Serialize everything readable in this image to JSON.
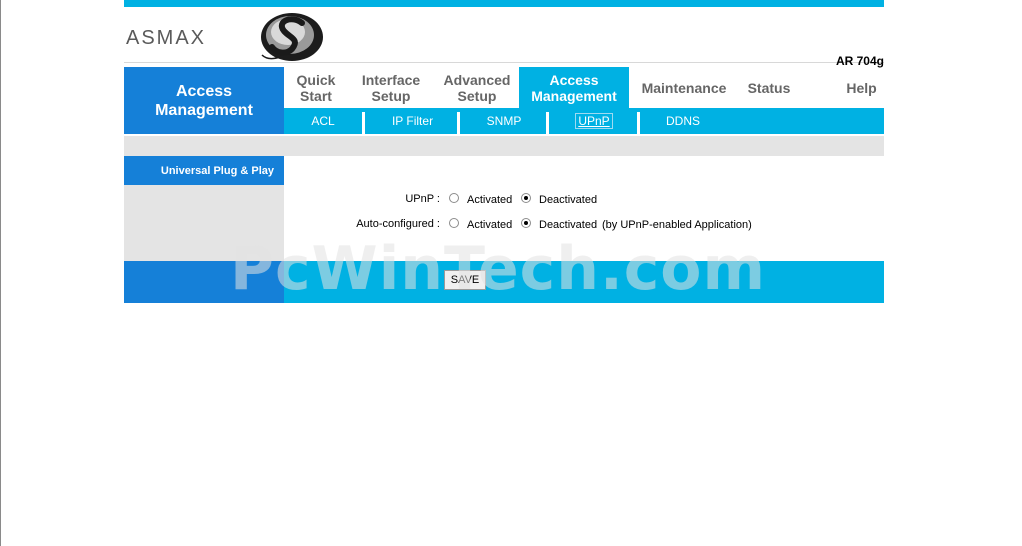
{
  "brand": {
    "name": "ASMAX",
    "model": "AR 704g"
  },
  "section_title": "Access\nManagement",
  "main_tabs": [
    {
      "label": "Quick\nStart"
    },
    {
      "label": "Interface\nSetup"
    },
    {
      "label": "Advanced\nSetup"
    },
    {
      "label": "Access\nManagement",
      "active": true
    },
    {
      "label": "Maintenance"
    },
    {
      "label": "Status"
    },
    {
      "label": "Help"
    }
  ],
  "sub_tabs": [
    {
      "label": "ACL"
    },
    {
      "label": "IP Filter"
    },
    {
      "label": "SNMP"
    },
    {
      "label": "UPnP",
      "active": true
    },
    {
      "label": "DDNS"
    }
  ],
  "sidebar": {
    "label": "Universal Plug & Play"
  },
  "form": {
    "upnp": {
      "label": "UPnP :",
      "activated": "Activated",
      "deactivated": "Deactivated",
      "selected": "Deactivated"
    },
    "auto_configured": {
      "label": "Auto-configured :",
      "activated": "Activated",
      "deactivated": "Deactivated",
      "note": "(by UPnP-enabled Application)",
      "selected": "Deactivated"
    }
  },
  "save_label": "SAVE",
  "watermark": "PcWinTech.com",
  "colors": {
    "accent": "#00b1e3",
    "section_blue": "#1580d8",
    "panel_gray": "#e4e4e4"
  }
}
